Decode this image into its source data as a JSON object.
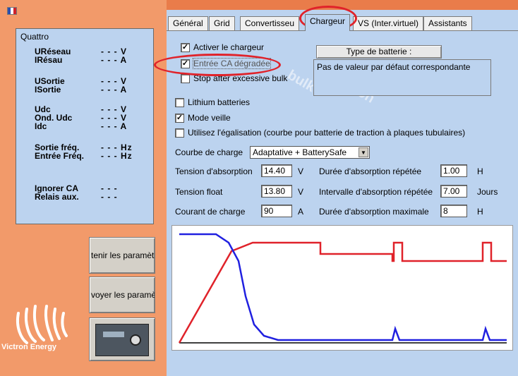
{
  "colors": {
    "accent_red": "#e0222a",
    "panel_blue": "#bcd3ef",
    "brand_orange": "#e97c4a"
  },
  "quattro": {
    "title": "Quattro",
    "rows": [
      {
        "label": "URéseau",
        "value": "- - - V"
      },
      {
        "label": "IRésau",
        "value": "- - - A"
      },
      {
        "label": "USortie",
        "value": "- - - V"
      },
      {
        "label": "ISortie",
        "value": "- - - A"
      },
      {
        "label": "Udc",
        "value": "- - - V"
      },
      {
        "label": "Ond. Udc",
        "value": "- - - V"
      },
      {
        "label": "Idc",
        "value": "- - - A"
      },
      {
        "label": "Sortie fréq.",
        "value": "- - - Hz"
      },
      {
        "label": "Entrée Fréq.",
        "value": "- - - Hz"
      },
      {
        "label": "Ignorer CA",
        "value": "- - -"
      },
      {
        "label": "Relais aux.",
        "value": "- - -"
      }
    ]
  },
  "side_buttons": {
    "get": "tenir les paramèt",
    "send": "voyer les paramè"
  },
  "brand": {
    "name": "Victron Energy"
  },
  "tabs": [
    "Général",
    "Grid",
    "Convertisseu",
    "Chargeur",
    "VS (Inter.virtuel)",
    "Assistants"
  ],
  "charger": {
    "enable_charger": "Activer le chargeur",
    "weak_ac": "Entrée CA dégradée",
    "stop_bulk": "Stop after excessive bulk",
    "lithium": "Lithium batteries",
    "standby": "Mode veille",
    "equalization": "Utilisez l'égalisation (courbe pour batterie de traction à plaques tubulaires)",
    "battery_type_button": "Type de batterie :",
    "battery_type_text": "Pas de valeur par défaut correspondante",
    "curve_label": "Courbe de charge",
    "curve_value": "Adaptative + BatterySafe",
    "absorption_voltage_label": "Tension d'absorption",
    "absorption_voltage": "14.40",
    "float_voltage_label": "Tension float",
    "float_voltage": "13.80",
    "charge_current_label": "Courant de charge",
    "charge_current": "90",
    "unit_v": "V",
    "unit_a": "A",
    "unit_h": "H",
    "unit_days": "Jours",
    "repeated_absorption_time_label": "Durée d'absorption répétée",
    "repeated_absorption_time": "1.00",
    "repeated_absorption_interval_label": "Intervalle d'absorption répétée",
    "repeated_absorption_interval": "7.00",
    "max_absorption_time_label": "Durée d'absorption maximale",
    "max_absorption_time": "8"
  }
}
